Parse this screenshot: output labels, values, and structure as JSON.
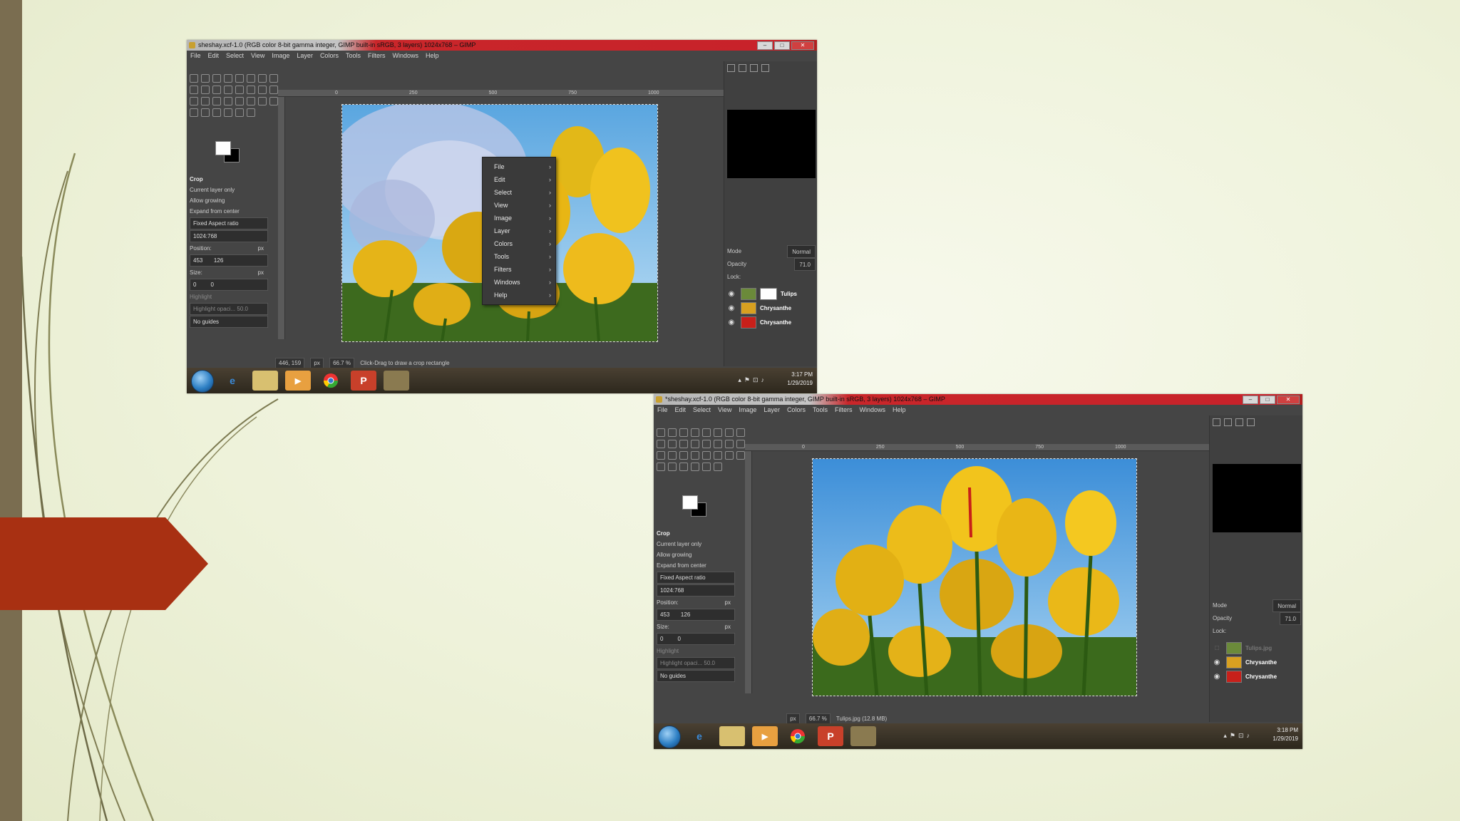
{
  "screenshot1": {
    "title": "sheshay.xcf-1.0 (RGB color 8-bit gamma integer, GIMP built-in sRGB, 3 layers) 1024x768 – GIMP",
    "menu": [
      "File",
      "Edit",
      "Select",
      "View",
      "Image",
      "Layer",
      "Colors",
      "Tools",
      "Filters",
      "Windows",
      "Help"
    ],
    "tool_options": {
      "tool": "Crop",
      "current_layer_only": "Current layer only",
      "allow_growing": "Allow growing",
      "expand_from_center": "Expand from center",
      "fixed": "Fixed   Aspect ratio",
      "ratio": "1024:768",
      "position_label": "Position:",
      "position_unit": "px",
      "position_x": "453",
      "position_y": "126",
      "size_label": "Size:",
      "size_unit": "px",
      "size_w": "0",
      "size_h": "0",
      "highlight": "Highlight",
      "highlight_opacity": "Highlight opaci...   50.0",
      "guides": "No guides"
    },
    "ruler_ticks": [
      "0",
      "250",
      "500",
      "750",
      "1000"
    ],
    "context_menu": [
      "File",
      "Edit",
      "Select",
      "View",
      "Image",
      "Layer",
      "Colors",
      "Tools",
      "Filters",
      "Windows",
      "Help"
    ],
    "status": {
      "coords": "446, 159",
      "unit": "px",
      "zoom": "66.7 %",
      "message": "Click-Drag to draw a crop rectangle"
    },
    "layers_panel": {
      "mode_label": "Mode",
      "mode": "Normal",
      "opacity_label": "Opacity",
      "opacity": "71.0",
      "lock_label": "Lock:",
      "layers": [
        "Tulips",
        "Chrysanthe",
        "Chrysanthe"
      ]
    },
    "taskbar": {
      "time": "3:17 PM",
      "date": "1/29/2019"
    }
  },
  "screenshot2": {
    "title": "*sheshay.xcf-1.0 (RGB color 8-bit gamma integer, GIMP built-in sRGB, 3 layers) 1024x768 – GIMP",
    "menu": [
      "File",
      "Edit",
      "Select",
      "View",
      "Image",
      "Layer",
      "Colors",
      "Tools",
      "Filters",
      "Windows",
      "Help"
    ],
    "tool_options": {
      "tool": "Crop",
      "current_layer_only": "Current layer only",
      "allow_growing": "Allow growing",
      "expand_from_center": "Expand from center",
      "fixed": "Fixed   Aspect ratio",
      "ratio": "1024:768",
      "position_label": "Position:",
      "position_unit": "px",
      "position_x": "453",
      "position_y": "126",
      "size_label": "Size:",
      "size_unit": "px",
      "size_w": "0",
      "size_h": "0",
      "highlight": "Highlight",
      "highlight_opacity": "Highlight opaci...   50.0",
      "guides": "No guides"
    },
    "ruler_ticks": [
      "0",
      "250",
      "500",
      "750",
      "1000"
    ],
    "status": {
      "unit": "px",
      "zoom": "66.7 %",
      "message": "Tulips.jpg (12.8 MB)"
    },
    "layers_panel": {
      "mode_label": "Mode",
      "mode": "Normal",
      "opacity_label": "Opacity",
      "opacity": "71.0",
      "lock_label": "Lock:",
      "layers": [
        "Tulips.jpg",
        "Chrysanthe",
        "Chrysanthe"
      ]
    },
    "taskbar": {
      "time": "3:18 PM",
      "date": "1/29/2019"
    }
  },
  "colors": {
    "slide_bg": "#eef2da",
    "accent_arrow": "#a83012",
    "left_bar": "#7a6d50",
    "gimp_bg": "#454545"
  }
}
